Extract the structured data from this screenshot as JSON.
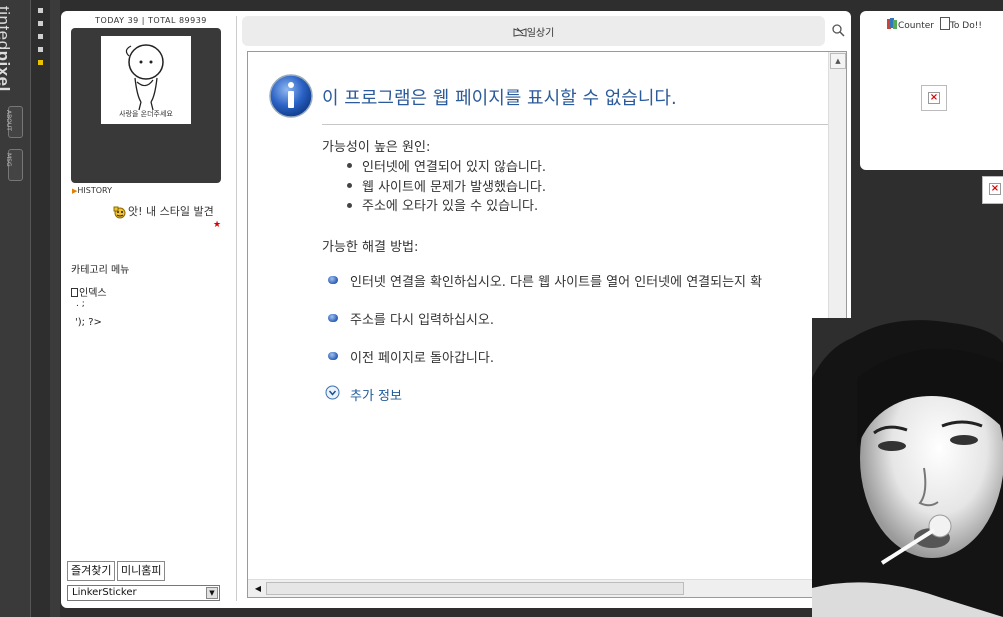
{
  "nav": {
    "logo_light": "tinted",
    "logo_bold": "pixel",
    "tabs": [
      "ABOUT",
      "MSG"
    ]
  },
  "sidebar": {
    "counter_text": "TODAY 39 | TOTAL 89939",
    "history_label": "HISTORY",
    "mood_text": "앗! 내 스타일 발견",
    "category_title": "카테고리 메뉴",
    "category_index": "인덱스",
    "category_junk1": ". ;",
    "category_junk2": "'); ?>",
    "favorites_button": "즐겨찾기",
    "minihompy_button": "미니홈피",
    "sticker_select": "LinkerSticker",
    "profile_caption": "사랑을 온더주세요"
  },
  "content": {
    "diary_title": "일상기",
    "error_title": "이 프로그램은 웹 페이지를 표시할 수 없습니다.",
    "causes_heading": "가능성이 높은 원인:",
    "causes": [
      "인터넷에 연결되어 있지 않습니다.",
      "웹 사이트에 문제가 발생했습니다.",
      "주소에 오타가 있을 수 있습니다."
    ],
    "solutions_heading": "가능한 해결 방법:",
    "solutions": [
      "인터넷 연결을 확인하십시오. 다른 웹 사이트를 열어 인터넷에 연결되는지 확",
      "주소를 다시 입력하십시오.",
      "이전 페이지로 돌아갑니다."
    ],
    "more_info": "추가 정보"
  },
  "widget": {
    "counter_label": "Counter",
    "todo_label": "To Do!!"
  },
  "colors": {
    "accent_blue": "#2c5b9b",
    "link_blue": "#1f5b9a",
    "dark_bg": "#2e2e2e"
  }
}
